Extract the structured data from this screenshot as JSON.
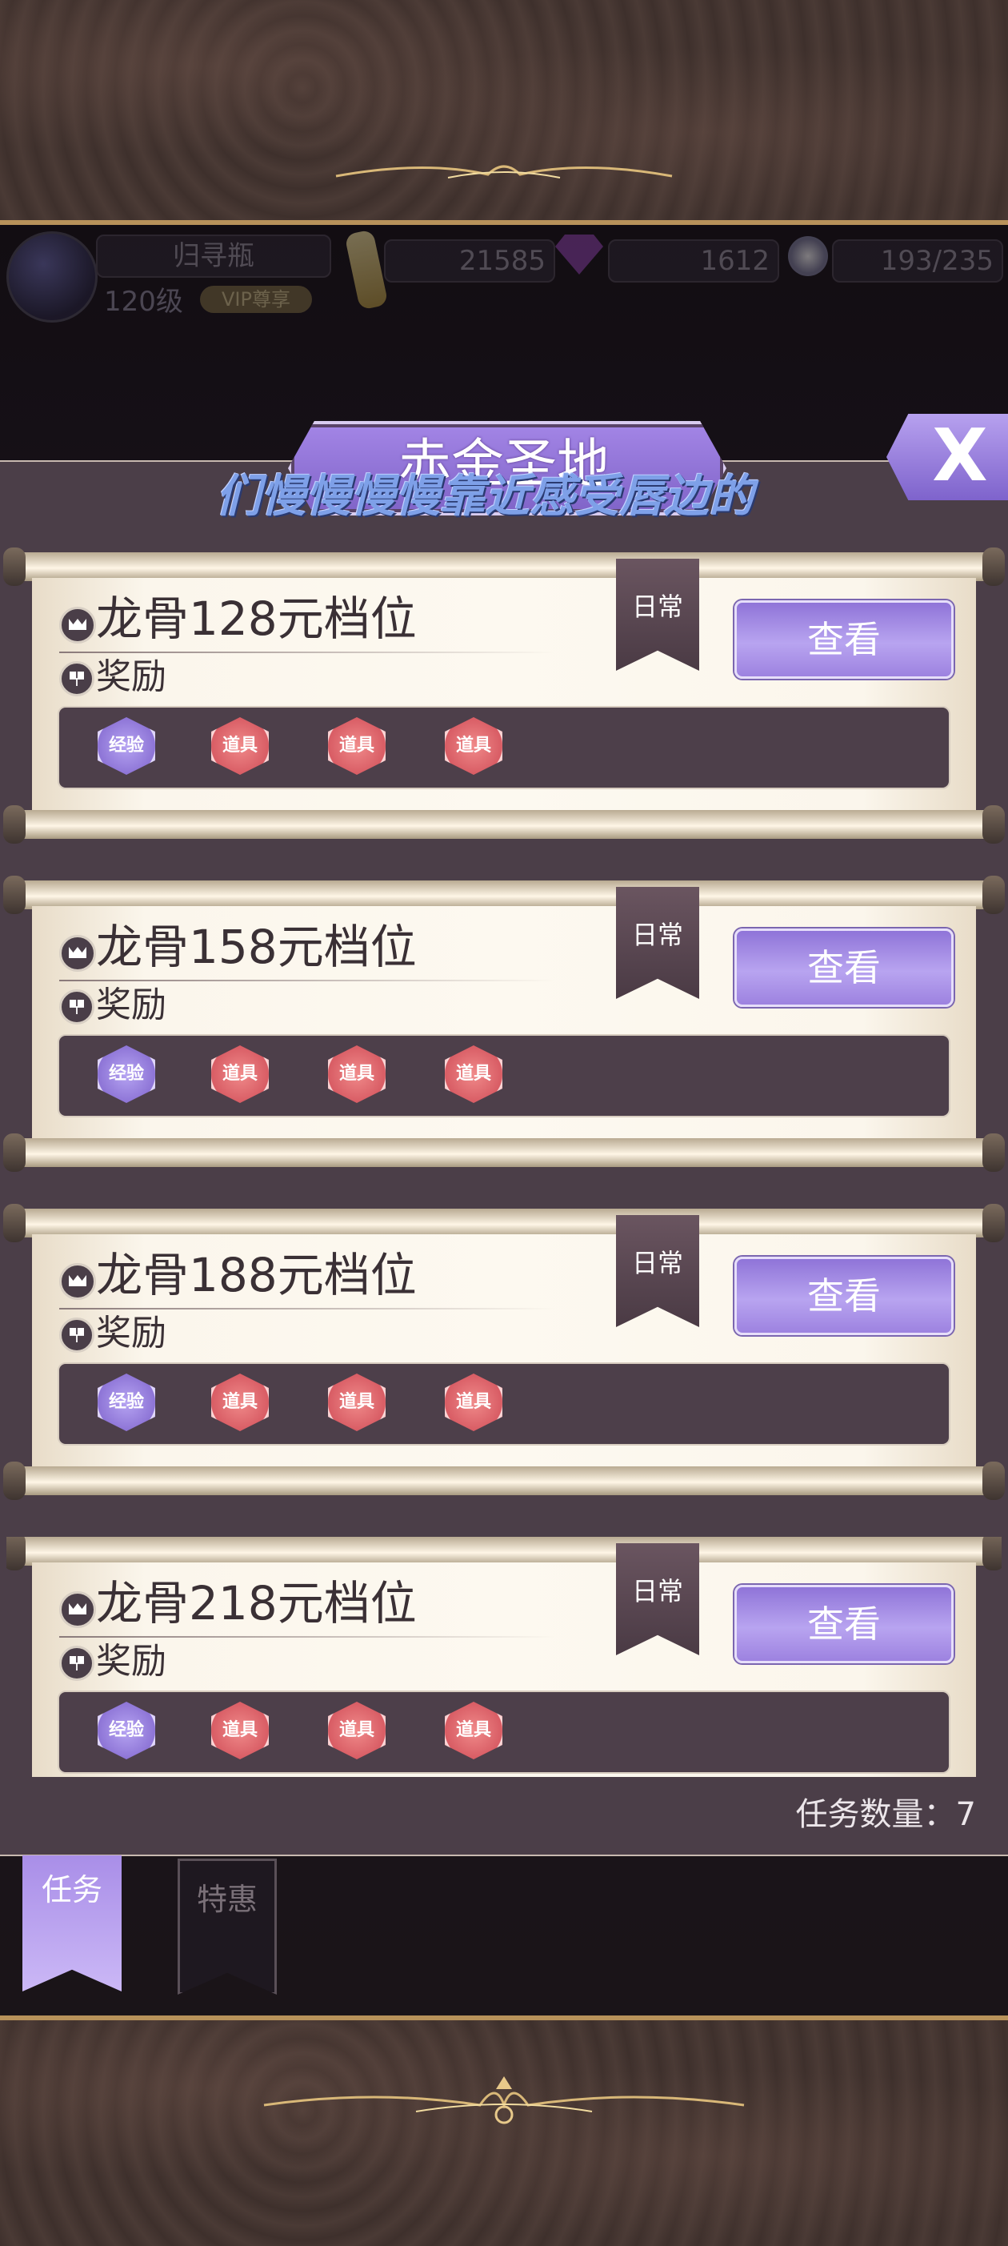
{
  "hud": {
    "player_name": "归寻瓶",
    "level": "120级",
    "vip": "VIP尊享",
    "gold": "21585",
    "gems": "1612",
    "energy": "193/235"
  },
  "panel": {
    "title": "赤金圣地",
    "marquee": "们慢慢慢慢靠近感受唇边的",
    "close_label": "X",
    "task_count_label": "任务数量：7"
  },
  "tiers": [
    {
      "title": "龙骨128元档位",
      "tag": "日常",
      "reward_label": "奖励",
      "button": "查看",
      "rewards": [
        "经验",
        "道具",
        "道具",
        "道具"
      ]
    },
    {
      "title": "龙骨158元档位",
      "tag": "日常",
      "reward_label": "奖励",
      "button": "查看",
      "rewards": [
        "经验",
        "道具",
        "道具",
        "道具"
      ]
    },
    {
      "title": "龙骨188元档位",
      "tag": "日常",
      "reward_label": "奖励",
      "button": "查看",
      "rewards": [
        "经验",
        "道具",
        "道具",
        "道具"
      ]
    },
    {
      "title": "龙骨218元档位",
      "tag": "日常",
      "reward_label": "奖励",
      "button": "查看",
      "rewards": [
        "经验",
        "道具",
        "道具",
        "道具"
      ]
    }
  ],
  "tabs": [
    {
      "label": "任务",
      "active": true
    },
    {
      "label": "特惠",
      "active": false
    }
  ],
  "colors": {
    "accent_purple": "#a98ee8",
    "panel_bg": "#4b3e48",
    "exp_badge": "#8d74d6",
    "item_badge": "#d85c64",
    "frame_gold": "#b8925a"
  }
}
